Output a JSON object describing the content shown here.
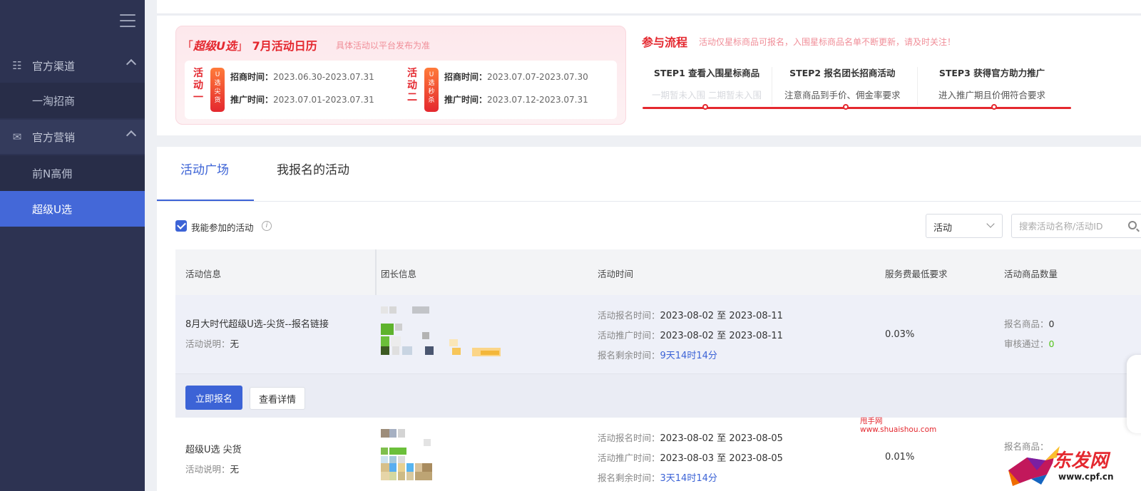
{
  "sidebar": {
    "groups": [
      {
        "label": "官方渠道",
        "icon": "org-chart-icon",
        "items": [
          {
            "label": "一淘招商"
          }
        ]
      },
      {
        "label": "官方营销",
        "icon": "megaphone-icon",
        "items": [
          {
            "label": "前N高佣"
          },
          {
            "label": "超级U选",
            "active": true
          }
        ]
      }
    ]
  },
  "calendar": {
    "bracket_open": "「",
    "brand": "超级U选",
    "bracket_close": "」",
    "title": "7月活动日历",
    "note": "具体活动以平台发布为准",
    "activities": [
      {
        "tag": [
          "活",
          "动",
          "一"
        ],
        "pill": [
          "U",
          "选",
          "尖",
          "货"
        ],
        "recruit_label": "招商时间：",
        "recruit": "2023.06.30-2023.07.31",
        "promo_label": "推广时间：",
        "promo": "2023.07.01-2023.07.31"
      },
      {
        "tag": [
          "活",
          "动",
          "二"
        ],
        "pill": [
          "U",
          "选",
          "秒",
          "杀"
        ],
        "recruit_label": "招商时间：",
        "recruit": "2023.07.07-2023.07.30",
        "promo_label": "推广时间：",
        "promo": "2023.07.12-2023.07.31"
      }
    ]
  },
  "flow": {
    "title": "参与流程",
    "note": "活动仅星标商品可报名，入围星标商品名单不断更新，请及时关注！",
    "steps": [
      {
        "title": "STEP1 查看入围星标商品",
        "desc": "一期暂未入围 二期暂未入围"
      },
      {
        "title": "STEP2 报名团长招商活动",
        "desc": "注意商品到手价、佣金率要求"
      },
      {
        "title": "STEP3 获得官方助力推广",
        "desc": "进入推广期且价佣符合要求"
      }
    ]
  },
  "tabs": [
    {
      "label": "活动广场",
      "active": true
    },
    {
      "label": "我报名的活动"
    }
  ],
  "filter": {
    "checkbox_label": "我能参加的活动",
    "checked": true,
    "select_value": "活动",
    "search_placeholder": "搜索活动名称/活动ID"
  },
  "table": {
    "headers": [
      "活动信息",
      "团长信息",
      "活动时间",
      "服务费最低要求",
      "活动商品数量"
    ],
    "rows": [
      {
        "name": "8月大时代超级U选-尖货--报名链接",
        "desc_label": "活动说明：",
        "desc": "无",
        "signup_label": "活动报名时间：",
        "signup": "2023-08-02 至 2023-08-11",
        "promo_label": "活动推广时间：",
        "promo": "2023-08-02 至 2023-08-11",
        "remain_label": "报名剩余时间：",
        "remain": "9天14时14分",
        "fee": "0.03%",
        "goods_label": "报名商品：",
        "goods": "0",
        "approved_label": "审核通过：",
        "approved": "0"
      },
      {
        "name": "超级U选 尖货",
        "desc_label": "活动说明：",
        "desc": "无",
        "signup_label": "活动报名时间：",
        "signup": "2023-08-02 至 2023-08-05",
        "promo_label": "活动推广时间：",
        "promo": "2023-08-03 至 2023-08-05",
        "remain_label": "报名剩余时间：",
        "remain": "3天14时14分",
        "fee": "0.01%",
        "goods_label": "报名商品："
      }
    ],
    "actions": {
      "apply": "立即报名",
      "detail": "查看详情"
    }
  },
  "watermark": {
    "line1": "甩手网",
    "line2": "www.shuaishou.com"
  },
  "logo": {
    "text": "东发网",
    "url": "www.cpf.cn"
  },
  "colors": {
    "primary": "#3c63d6",
    "sidebar": "#2d3352",
    "accent_red": "#e4282f",
    "success": "#52c41a"
  }
}
